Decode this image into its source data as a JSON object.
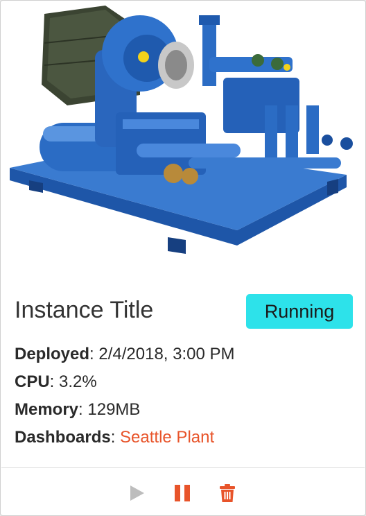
{
  "card": {
    "image_icon": "industrial-compressor-photo",
    "title": "Instance Title",
    "status": "Running",
    "details": [
      {
        "label": "Deployed",
        "separator": ": ",
        "value": "2/4/2018, 3:00 PM"
      },
      {
        "label": "CPU",
        "separator": ": ",
        "value": "3.2%"
      },
      {
        "label": "Memory",
        "separator": ": ",
        "value": "129MB"
      },
      {
        "label": "Dashboards",
        "separator": ": ",
        "value": "Seattle Plant"
      }
    ],
    "actions": [
      {
        "icon": "play-icon",
        "enabled": false
      },
      {
        "icon": "pause-icon",
        "enabled": true
      },
      {
        "icon": "trash-icon",
        "enabled": true
      }
    ]
  },
  "colors": {
    "status_bg": "#2de2ea",
    "accent": "#e8542a",
    "disabled": "#bdbdbd"
  }
}
